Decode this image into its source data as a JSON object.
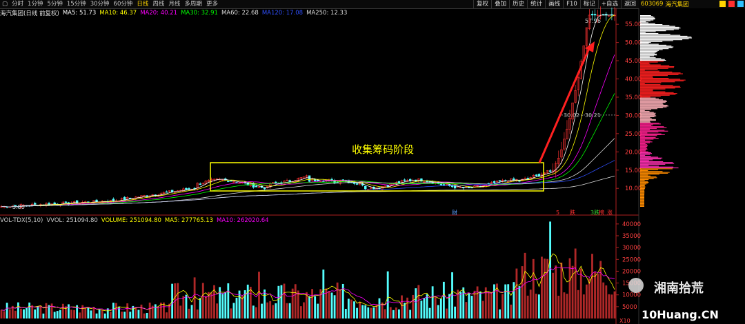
{
  "toolbar": {
    "periods": [
      {
        "label": "分时",
        "active": false
      },
      {
        "label": "1分钟",
        "active": false
      },
      {
        "label": "5分钟",
        "active": false
      },
      {
        "label": "15分钟",
        "active": false
      },
      {
        "label": "30分钟",
        "active": false
      },
      {
        "label": "60分钟",
        "active": false
      },
      {
        "label": "日线",
        "active": true
      },
      {
        "label": "周线",
        "active": false
      },
      {
        "label": "月线",
        "active": false
      },
      {
        "label": "多周期",
        "active": false
      },
      {
        "label": "更多",
        "active": false
      }
    ],
    "buttons": [
      "复权",
      "叠加",
      "历史",
      "统计",
      "画线",
      "F10",
      "标记",
      "+自选",
      "返回"
    ]
  },
  "chart_title": "海汽集团(日线 前复权)",
  "ma_legend": [
    {
      "label": "MA5: 51.73",
      "color": "#ffffff"
    },
    {
      "label": "MA10: 46.37",
      "color": "#ffff00"
    },
    {
      "label": "MA20: 40.21",
      "color": "#ff00ff"
    },
    {
      "label": "MA30: 32.91",
      "color": "#00ff00"
    },
    {
      "label": "MA60: 22.68",
      "color": "#dddddd"
    },
    {
      "label": "MA120: 17.08",
      "color": "#3050ff"
    },
    {
      "label": "MA250: 12.33",
      "color": "#dddddd"
    }
  ],
  "vol_legend": [
    {
      "label": "VOL-TDX(5,10)",
      "color": "#cccccc"
    },
    {
      "label": "VVOL: 251094.80",
      "color": "#cccccc"
    },
    {
      "label": "VOLUME: 251094.80",
      "color": "#ffff00"
    },
    {
      "label": "MA5: 277765.13",
      "color": "#ffff00"
    },
    {
      "label": "MA10: 262020.64",
      "color": "#ff00ff"
    }
  ],
  "annotation": "收集筹码阶段",
  "price_labels": {
    "high": "57.96",
    "low": "3.80",
    "mid_range": "30.02 - 30.21"
  },
  "price_axis": [
    "55.00",
    "50.00",
    "45.00",
    "40.00",
    "35.00",
    "30.00",
    "25.00",
    "20.00",
    "15.00",
    "10.00"
  ],
  "vol_axis": [
    "40000",
    "35000",
    "30000",
    "25000",
    "20000",
    "15000",
    "10000",
    "5000"
  ],
  "vol_unit": "X10",
  "markers": [
    {
      "text": "财",
      "color": "#5aa0ff"
    },
    {
      "text": "5",
      "color": "#ff3030"
    },
    {
      "text": "跌",
      "color": "#ff3030"
    },
    {
      "text": "3跌",
      "color": "#30d030"
    },
    {
      "text": "榜",
      "color": "#ff3030"
    },
    {
      "text": "涨",
      "color": "#ff3030"
    }
  ],
  "right_panel": {
    "code": "603069",
    "name": "海汽集团"
  },
  "watermark": {
    "line1": "湘南拾荒",
    "line2": "10Huang.CN"
  },
  "chart_data": {
    "type": "candlestick+volume",
    "price_ylim": [
      3.8,
      59
    ],
    "price_ticks": [
      10,
      15,
      20,
      25,
      30,
      35,
      40,
      45,
      50,
      55
    ],
    "high": 57.96,
    "low": 3.8,
    "ma": {
      "MA5": 51.73,
      "MA10": 46.37,
      "MA20": 40.21,
      "MA30": 32.91,
      "MA60": 22.68,
      "MA120": 17.08,
      "MA250": 12.33
    },
    "vol_ylim": [
      0,
      42000
    ],
    "vol_ticks": [
      5000,
      10000,
      15000,
      20000,
      25000,
      30000,
      35000,
      40000
    ],
    "volume_last": 251094.8,
    "volume_ma5": 277765.13,
    "volume_ma10": 262020.64
  },
  "colors": {
    "up": "#ff3232",
    "down": "#54ffff",
    "axis": "#b02020",
    "box": "#ffff00",
    "arrow": "#ff2020"
  }
}
